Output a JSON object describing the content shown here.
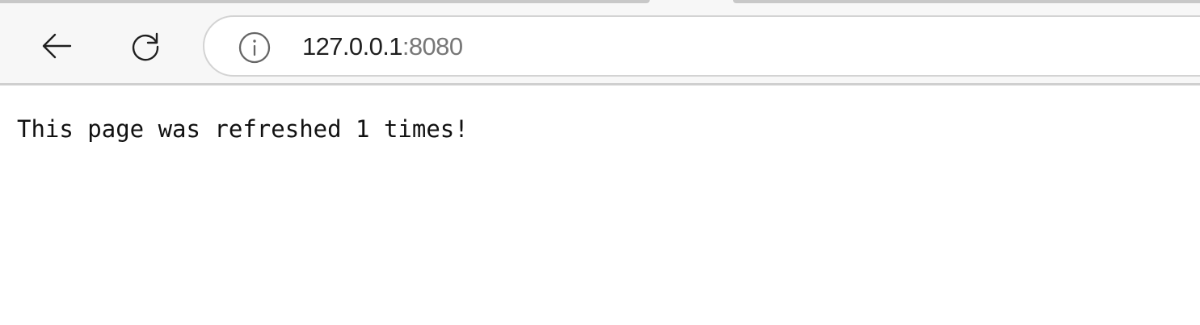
{
  "browser": {
    "toolbar": {
      "back_icon": "arrow-left-icon",
      "refresh_icon": "refresh-icon",
      "site_info_icon": "info-circle-icon"
    },
    "address_bar": {
      "host": "127.0.0.1",
      "port": ":8080"
    }
  },
  "page": {
    "message": "This page was refreshed 1 times!"
  },
  "colors": {
    "toolbar_background": "#f7f7f7",
    "address_text": "#1f1f1f",
    "port_text": "#777777",
    "page_background": "#ffffff"
  }
}
